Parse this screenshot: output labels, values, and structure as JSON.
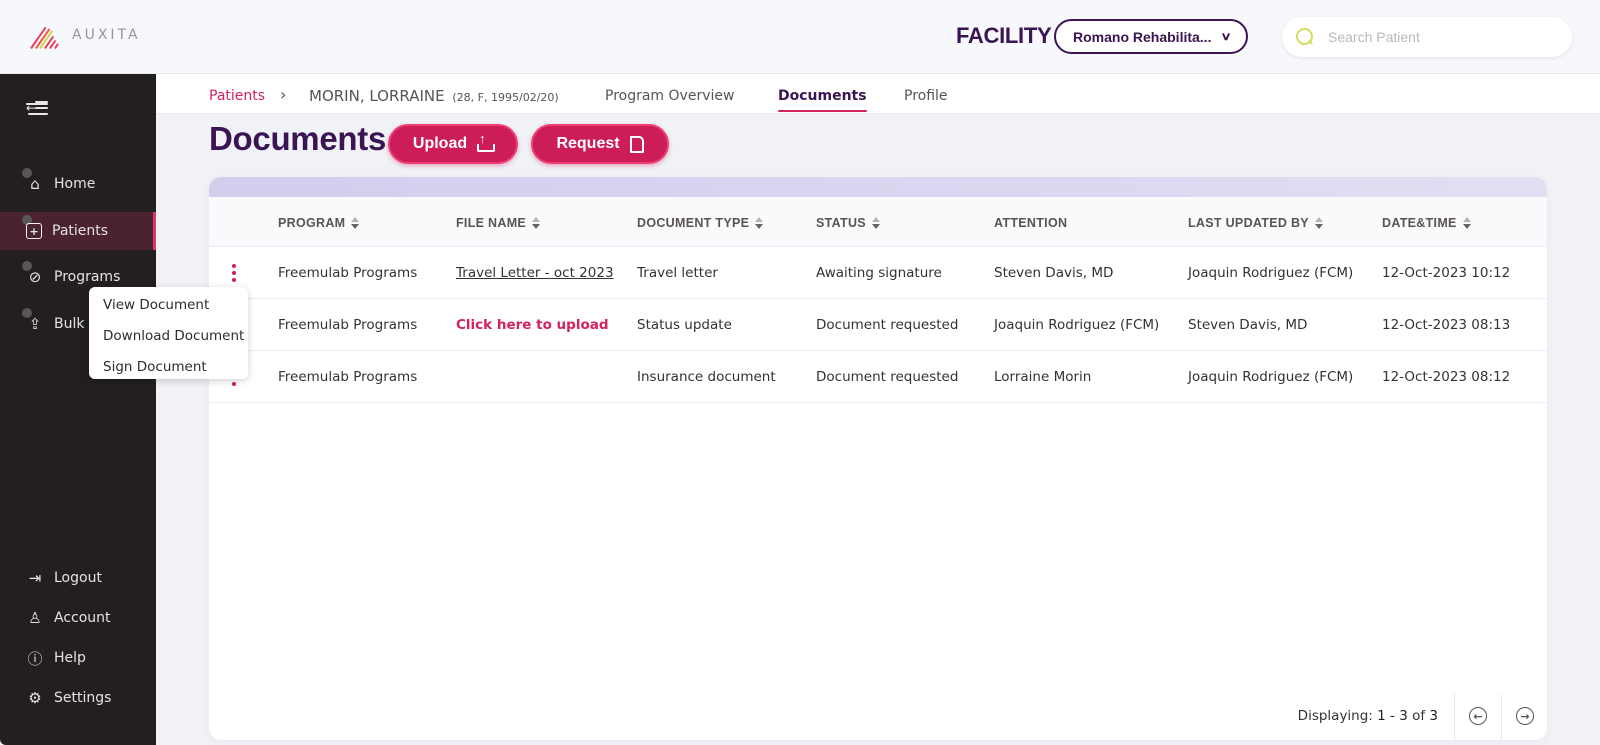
{
  "header": {
    "brand": "AUXITA",
    "facility_label": "FACILITY",
    "facility_selected": "Romano Rehabilita...",
    "search_placeholder": "Search Patient"
  },
  "sidebar": {
    "items": [
      {
        "label": "Home",
        "icon": "home-icon"
      },
      {
        "label": "Patients",
        "icon": "patients-icon",
        "active": true
      },
      {
        "label": "Programs",
        "icon": "programs-icon"
      },
      {
        "label": "Bulk A",
        "icon": "upload-icon"
      }
    ],
    "bottom_items": [
      {
        "label": "Logout",
        "icon": "logout-icon"
      },
      {
        "label": "Account",
        "icon": "account-icon"
      },
      {
        "label": "Help",
        "icon": "help-icon"
      },
      {
        "label": "Settings",
        "icon": "settings-icon"
      }
    ]
  },
  "context_menu": {
    "items": [
      "View Document",
      "Download Document",
      "Sign Document"
    ]
  },
  "breadcrumb": {
    "root": "Patients",
    "patient_name": "MORIN, LORRAINE",
    "patient_meta": "(28, F, 1995/02/20)"
  },
  "tabs": [
    {
      "label": "Program Overview",
      "active": false
    },
    {
      "label": "Documents",
      "active": true
    },
    {
      "label": "Profile",
      "active": false
    }
  ],
  "page": {
    "title": "Documents",
    "upload_label": "Upload",
    "request_label": "Request"
  },
  "table": {
    "columns": [
      "PROGRAM",
      "FILE NAME",
      "DOCUMENT TYPE",
      "STATUS",
      "ATTENTION",
      "LAST UPDATED BY",
      "DATE&TIME"
    ],
    "rows": [
      {
        "program": "Freemulab Programs",
        "file_name": "Travel Letter - oct 2023",
        "document_type": "Travel letter",
        "status": "Awaiting signature",
        "attention": "Steven Davis, MD",
        "last_updated_by": "Joaquin Rodriguez (FCM)",
        "datetime": "12-Oct-2023 10:12"
      },
      {
        "program": "Freemulab Programs",
        "file_name": "Click here to upload",
        "document_type": "Status update",
        "status": "Document requested",
        "attention": "Joaquin Rodriguez (FCM)",
        "last_updated_by": "Steven Davis, MD",
        "datetime": "12-Oct-2023 08:13"
      },
      {
        "program": "Freemulab Programs",
        "file_name": "",
        "document_type": "Insurance document",
        "status": "Document requested",
        "attention": "Lorraine Morin",
        "last_updated_by": "Joaquin Rodriguez (FCM)",
        "datetime": "12-Oct-2023 08:12"
      }
    ]
  },
  "pagination": {
    "prefix": "Displaying:",
    "range": "1 - 3",
    "of_label": "of",
    "total": "3"
  },
  "colors": {
    "brand_purple": "#3b1553",
    "accent_pink": "#cc1d5a",
    "sidebar_bg": "#231f20",
    "active_nav_bg": "#4b2230"
  }
}
